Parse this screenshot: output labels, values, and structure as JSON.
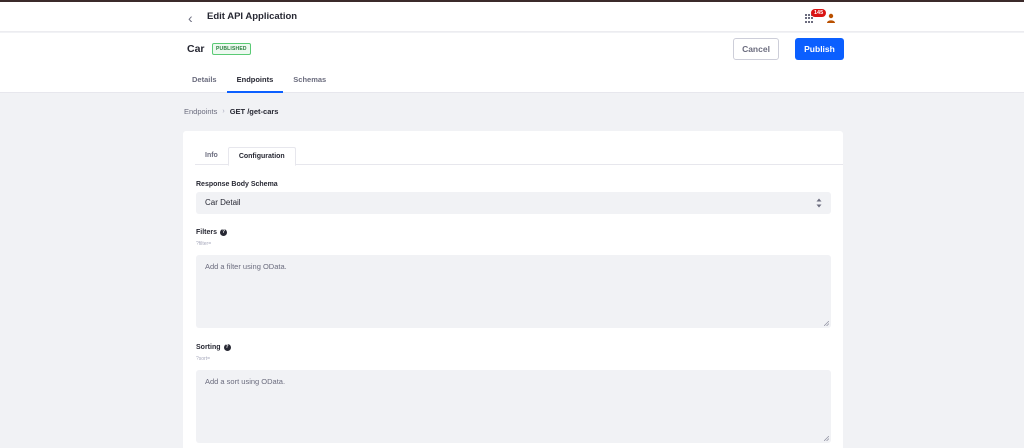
{
  "header": {
    "title": "Edit API Application",
    "notification_count": "145"
  },
  "application": {
    "name": "Car",
    "status": "PUBLISHED",
    "cancel_label": "Cancel",
    "publish_label": "Publish"
  },
  "nav_tabs": [
    {
      "label": "Details",
      "active": false
    },
    {
      "label": "Endpoints",
      "active": true
    },
    {
      "label": "Schemas",
      "active": false
    }
  ],
  "breadcrumb": {
    "parent": "Endpoints",
    "current": "GET /get-cars"
  },
  "card_tabs": [
    {
      "label": "Info",
      "active": false
    },
    {
      "label": "Configuration",
      "active": true
    }
  ],
  "config": {
    "response_schema_label": "Response Body Schema",
    "response_schema_value": "Car Detail",
    "filters_label": "Filters",
    "filters_param": "?filter=",
    "filters_placeholder": "Add a filter using OData.",
    "sorting_label": "Sorting",
    "sorting_param": "?sort=",
    "sorting_placeholder": "Add a sort using OData."
  },
  "colors": {
    "primary": "#0b5fff",
    "published_text": "#287d3c",
    "badge": "#da1414"
  }
}
